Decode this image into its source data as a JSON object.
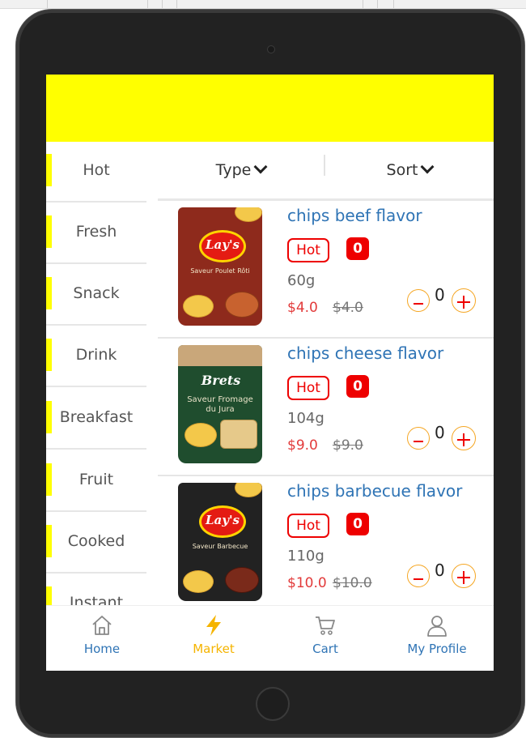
{
  "sidebar": {
    "categories": [
      "Hot",
      "Fresh",
      "Snack",
      "Drink",
      "Breakfast",
      "Fruit",
      "Cooked",
      "Instant"
    ]
  },
  "filter": {
    "type_label": "Type",
    "sort_label": "Sort"
  },
  "products": [
    {
      "name": "chips beef flavor",
      "tag": "Hot",
      "badge": "0",
      "weight": "60g",
      "price": "$4.0",
      "original_price": "$4.0",
      "quantity": "0",
      "bag_color": "#8e2a1c",
      "bag_logo": "Lay's",
      "bag_text": "Saveur Poulet Rôti"
    },
    {
      "name": "chips cheese flavor",
      "tag": "Hot",
      "badge": "0",
      "weight": "104g",
      "price": "$9.0",
      "original_price": "$9.0",
      "quantity": "0",
      "bag_color": "#1f4d2e",
      "bag_logo": "Brets",
      "bag_text": "Saveur Fromage du Jura"
    },
    {
      "name": "chips barbecue flavor",
      "tag": "Hot",
      "badge": "0",
      "weight": "110g",
      "price": "$10.0",
      "original_price": "$10.0",
      "quantity": "0",
      "bag_color": "#222222",
      "bag_logo": "Lay's",
      "bag_text": "Saveur Barbecue"
    }
  ],
  "tabbar": {
    "items": [
      {
        "label": "Home",
        "icon": "home-icon",
        "active": false
      },
      {
        "label": "Market",
        "icon": "lightning-icon",
        "active": true
      },
      {
        "label": "Cart",
        "icon": "cart-icon",
        "active": false
      },
      {
        "label": "My Profile",
        "icon": "profile-icon",
        "active": false
      }
    ]
  },
  "colors": {
    "accent": "#ffff00",
    "active_tab": "#f5b400",
    "inactive_tab": "#2f74b5",
    "price": "#e23a3a",
    "hot": "#ee0000",
    "title": "#2f74b5"
  }
}
